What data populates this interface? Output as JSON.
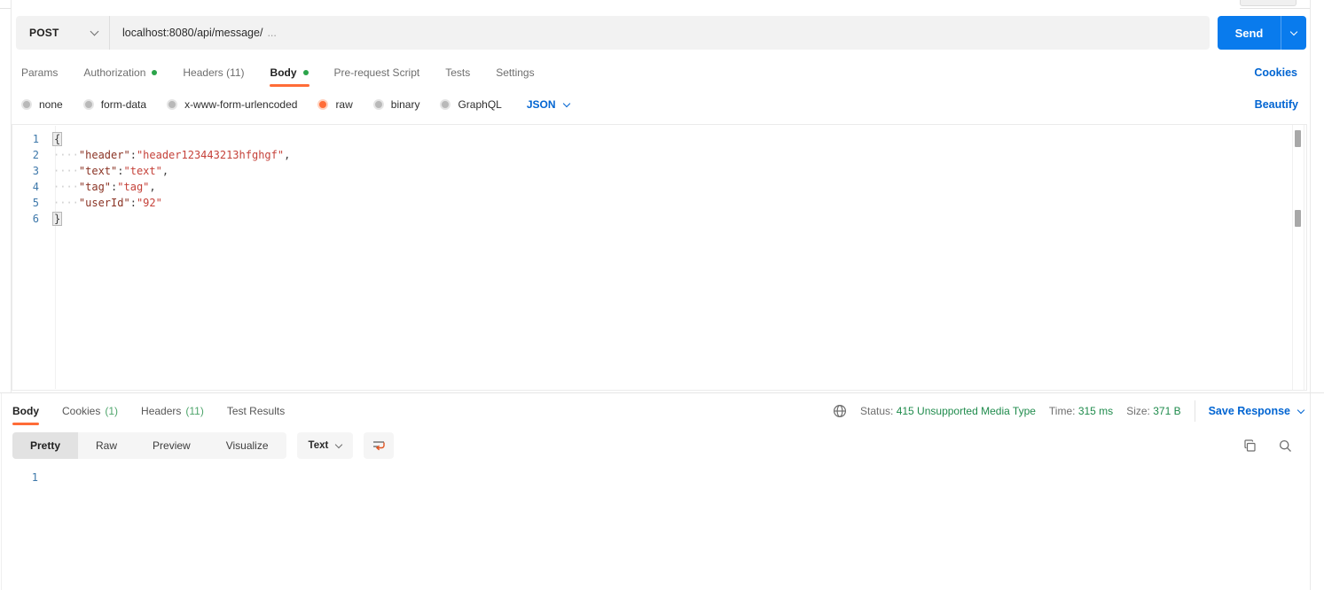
{
  "request": {
    "method": "POST",
    "url": "localhost:8080/api/message/",
    "url_hint": "...",
    "send_label": "Send",
    "cookies_link": "Cookies",
    "beautify_link": "Beautify",
    "tabs": [
      {
        "label": "Params"
      },
      {
        "label": "Authorization"
      },
      {
        "label": "Headers (11)"
      },
      {
        "label": "Body"
      },
      {
        "label": "Pre-request Script"
      },
      {
        "label": "Tests"
      },
      {
        "label": "Settings"
      }
    ],
    "active_tab": "Body",
    "body_modes": [
      {
        "label": "none"
      },
      {
        "label": "form-data"
      },
      {
        "label": "x-www-form-urlencoded"
      },
      {
        "label": "raw"
      },
      {
        "label": "binary"
      },
      {
        "label": "GraphQL"
      }
    ],
    "selected_mode": "raw",
    "language": "JSON",
    "editor_lines": [
      {
        "num": "1",
        "tokens": [
          {
            "t": "brace",
            "s": "{"
          }
        ]
      },
      {
        "num": "2",
        "tokens": [
          {
            "t": "ws",
            "s": "····"
          },
          {
            "t": "key",
            "s": "\"header\""
          },
          {
            "t": "pun",
            "s": ":"
          },
          {
            "t": "val",
            "s": "\"header123443213hfghgf\""
          },
          {
            "t": "pun",
            "s": ","
          }
        ]
      },
      {
        "num": "3",
        "tokens": [
          {
            "t": "ws",
            "s": "····"
          },
          {
            "t": "key",
            "s": "\"text\""
          },
          {
            "t": "pun",
            "s": ":"
          },
          {
            "t": "val",
            "s": "\"text\""
          },
          {
            "t": "pun",
            "s": ","
          }
        ]
      },
      {
        "num": "4",
        "tokens": [
          {
            "t": "ws",
            "s": "····"
          },
          {
            "t": "key",
            "s": "\"tag\""
          },
          {
            "t": "pun",
            "s": ":"
          },
          {
            "t": "val",
            "s": "\"tag\""
          },
          {
            "t": "pun",
            "s": ","
          }
        ]
      },
      {
        "num": "5",
        "tokens": [
          {
            "t": "ws",
            "s": "····"
          },
          {
            "t": "key",
            "s": "\"userId\""
          },
          {
            "t": "pun",
            "s": ":"
          },
          {
            "t": "val",
            "s": "\"92\""
          }
        ]
      },
      {
        "num": "6",
        "tokens": [
          {
            "t": "brace",
            "s": "}"
          }
        ]
      }
    ]
  },
  "response": {
    "tabs": [
      {
        "label": "Body",
        "count": ""
      },
      {
        "label": "Cookies",
        "count": "(1)"
      },
      {
        "label": "Headers",
        "count": "(11)"
      },
      {
        "label": "Test Results",
        "count": ""
      }
    ],
    "active_tab": "Body",
    "status_label": "Status:",
    "status_value": "415 Unsupported Media Type",
    "time_label": "Time:",
    "time_value": "315 ms",
    "size_label": "Size:",
    "size_value": "371 B",
    "save_response_label": "Save Response",
    "views": [
      {
        "label": "Pretty"
      },
      {
        "label": "Raw"
      },
      {
        "label": "Preview"
      },
      {
        "label": "Visualize"
      }
    ],
    "active_view": "Pretty",
    "format_select": "Text",
    "editor_lines": [
      {
        "num": "1",
        "tokens": []
      }
    ]
  },
  "colors": {
    "accent_orange": "#ff6c37",
    "link_blue": "#0265d2",
    "send_button_blue": "#097bed",
    "tab_dot_green": "#2ba44a",
    "status_value_green": "#1f8b4c",
    "count_green": "#4fa56c",
    "code_key": "#8a3324",
    "code_value": "#c5423a",
    "line_number_blue": "#3e78aa"
  },
  "icons": {
    "method_caret": "chevron-down",
    "send_caret": "chevron-down",
    "language_caret": "chevron-down",
    "format_caret": "chevron-down",
    "save_caret": "chevron-down",
    "network": "globe",
    "copy": "overlapping-squares",
    "search": "magnifier",
    "wrap": "text-wrap-arrow"
  }
}
